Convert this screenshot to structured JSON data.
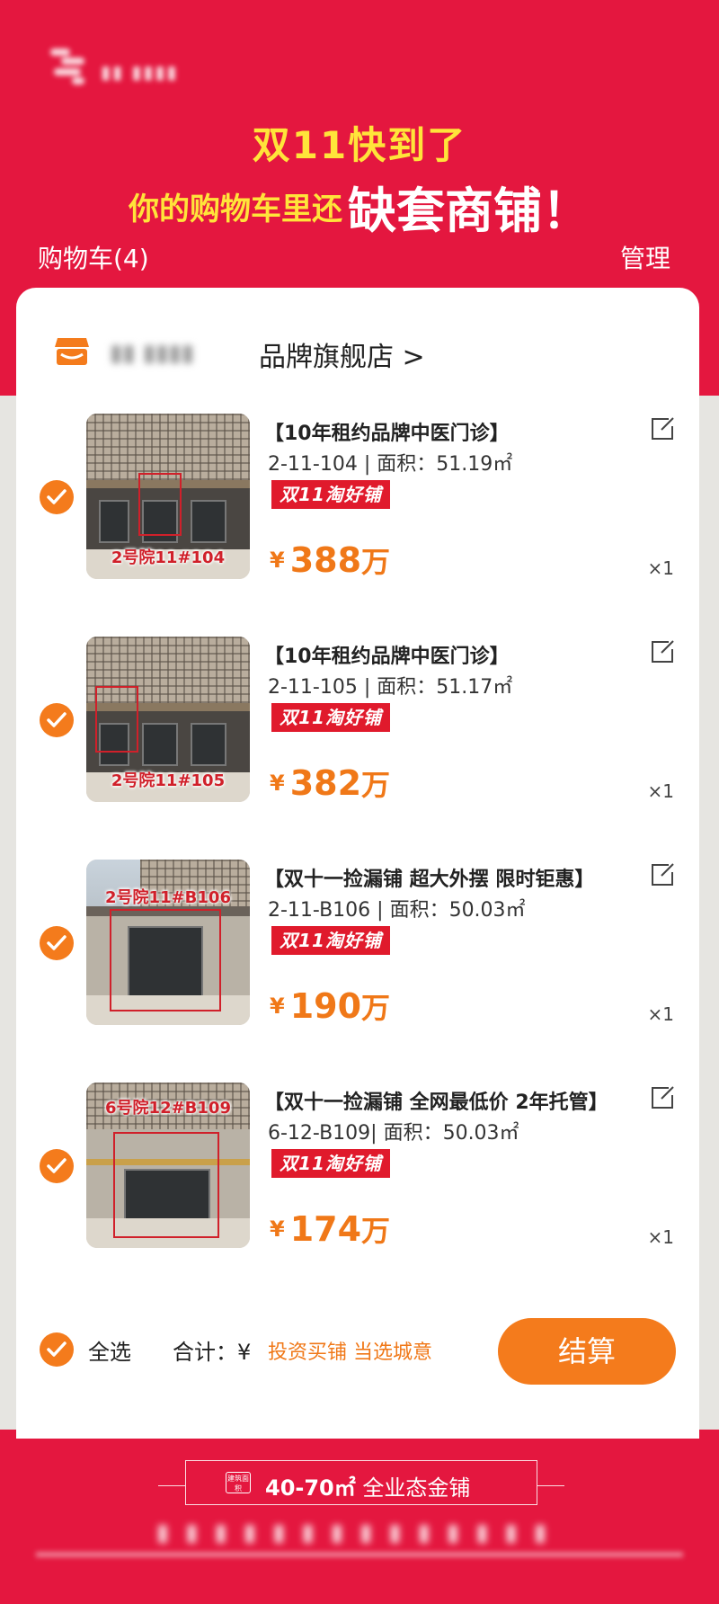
{
  "header": {
    "headline_line1": "双11快到了",
    "headline_line2_small": "你的购物车里还",
    "headline_line2_big": "缺套商铺！",
    "cart_title": "购物车(4)",
    "manage_label": "管理"
  },
  "store": {
    "name": "品牌旗舰店 >",
    "icon": "shop-icon"
  },
  "items": [
    {
      "title": "【10年租约品牌中医门诊】",
      "spec": "2-11-104 | 面积：51.19㎡",
      "promo": "双11淘好铺",
      "image_tag": "2号院11#104",
      "currency": "¥",
      "price": "388",
      "unit": "万",
      "qty": "×1",
      "checked": true
    },
    {
      "title": "【10年租约品牌中医门诊】",
      "spec": "2-11-105 | 面积：51.17㎡",
      "promo": "双11淘好铺",
      "image_tag": "2号院11#105",
      "currency": "¥",
      "price": "382",
      "unit": "万",
      "qty": "×1",
      "checked": true
    },
    {
      "title": "【双十一捡漏铺 超大外摆  限时钜惠】",
      "spec": "2-11-B106 | 面积：50.03㎡",
      "promo": "双11淘好铺",
      "image_tag": "2号院11#B106",
      "currency": "¥",
      "price": "190",
      "unit": "万",
      "qty": "×1",
      "checked": true
    },
    {
      "title": "【双十一捡漏铺 全网最低价 2年托管】",
      "spec": "6-12-B109| 面积：50.03㎡",
      "promo": "双11淘好铺",
      "image_tag": "6号院12#B109",
      "currency": "¥",
      "price": "174",
      "unit": "万",
      "qty": "×1",
      "checked": true
    }
  ],
  "footer": {
    "select_all_label": "全选",
    "total_label": "合计：¥",
    "slogan": "投资买铺 当选城意",
    "checkout_label": "结算"
  },
  "banner": {
    "badge_text": "建筑面积",
    "area": "40-70㎡",
    "text": "全业态金铺"
  },
  "colors": {
    "brand_red": "#e4173f",
    "accent_orange": "#f47b1c",
    "headline_yellow": "#ffe43a"
  }
}
